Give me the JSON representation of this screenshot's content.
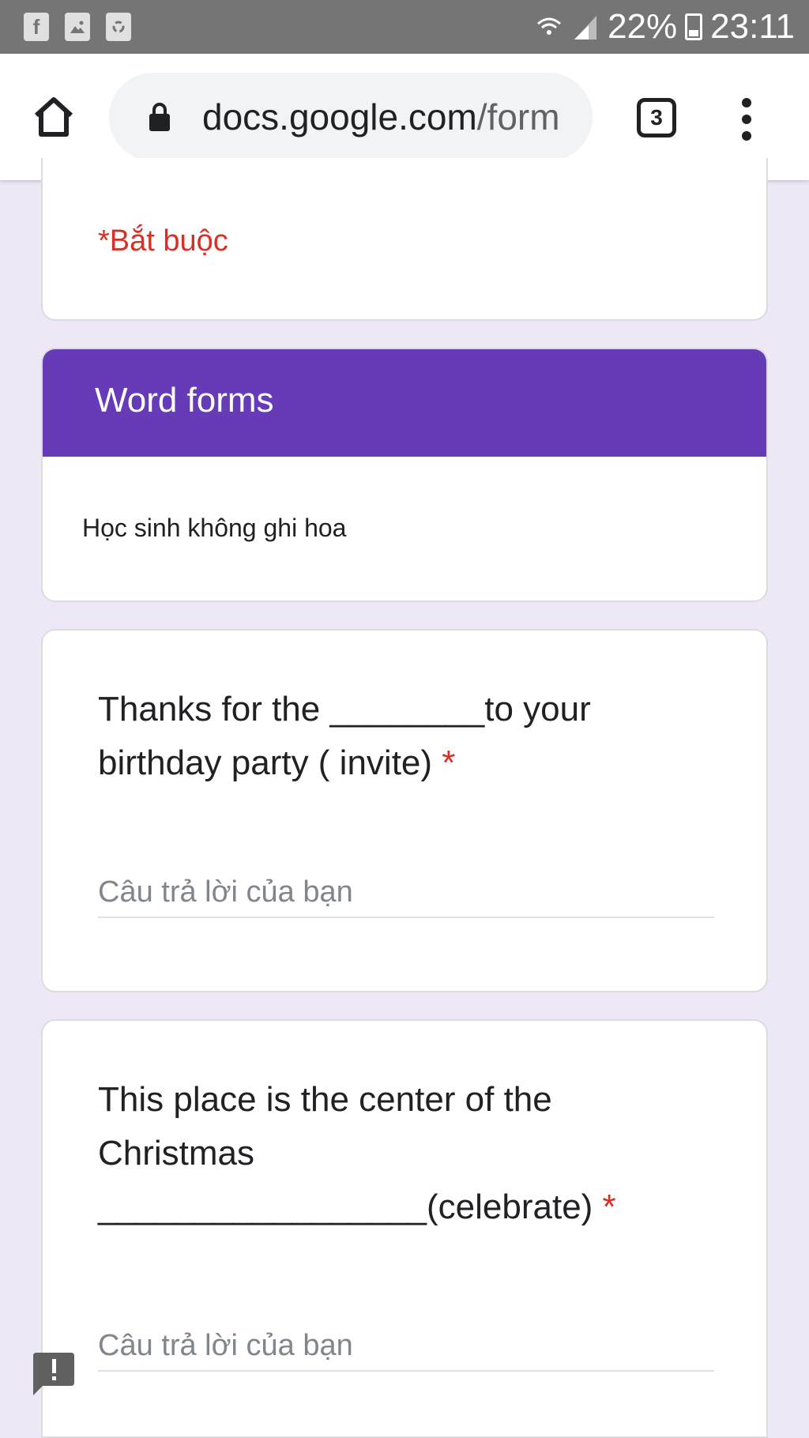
{
  "status_bar": {
    "icons": [
      "facebook-icon",
      "image-icon",
      "recycle-icon",
      "wifi-icon",
      "signal-icon",
      "battery-icon"
    ],
    "battery": "22%",
    "time": "23:11"
  },
  "browser": {
    "url_main": "docs.google.com",
    "url_path": "/form",
    "tab_count": "3"
  },
  "form": {
    "required_note": "*Bắt buộc",
    "section": {
      "title": "Word forms",
      "description": "Học sinh không ghi hoa"
    },
    "questions": [
      {
        "text": "Thanks for the ________to your birthday party ( invite)",
        "required_mark": "*",
        "placeholder": "Câu trả lời của bạn"
      },
      {
        "text": "This place is the center of the Christmas _________________(celebrate)",
        "required_mark": "*",
        "placeholder": "Câu trả lời của bạn"
      }
    ]
  },
  "colors": {
    "accent": "#673ab7",
    "background": "#ede7f6",
    "required": "#d93025",
    "status_bar": "#757575"
  }
}
